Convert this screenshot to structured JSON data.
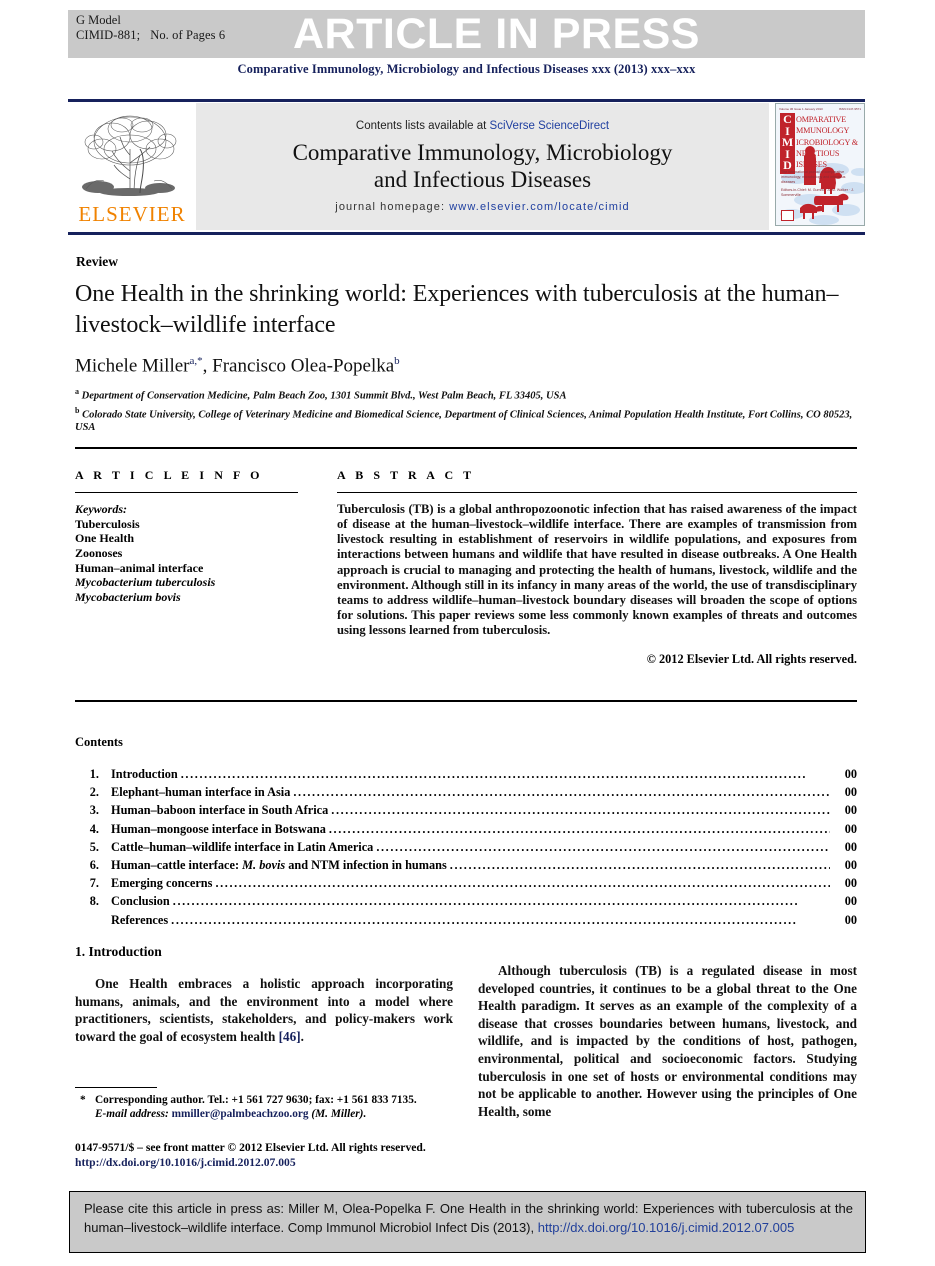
{
  "banner": {
    "gmodel_label": "G Model",
    "article_id": "CIMID-881;",
    "pages_label": "No. of Pages 6",
    "press_label": "ARTICLE IN PRESS"
  },
  "running_head": "Comparative Immunology, Microbiology and Infectious Diseases xxx (2013) xxx–xxx",
  "masthead": {
    "contents_prefix": "Contents lists available at",
    "sciencedirect": "SciVerse ScienceDirect",
    "journal_title_line1": "Comparative Immunology, Microbiology",
    "journal_title_line2": "and Infectious Diseases",
    "homepage_label": "journal homepage:",
    "homepage_url": "www.elsevier.com/locate/cimid",
    "publisher_wordmark": "ELSEVIER",
    "publisher_color": "#f08200",
    "accent_color": "#16215c",
    "cover": {
      "volume_line_left": "Volume 36  Issue 1  January 2013",
      "volume_line_right": "ISSN 0147-9571",
      "spine_code": "CIMID",
      "title_lines": [
        "OMPARATIVE",
        "MMUNOLOGY",
        "ICROBIOLOGY  &",
        "NFECTIOUS",
        "ISEASES"
      ],
      "subtitle": "The international journal of comparative immunology, microbiology and infectious diseases",
      "editors": "Editors-in-Chief: M. Gumbo · A. M. Walker · J. Sommerville"
    }
  },
  "article": {
    "type_label": "Review",
    "title": "One Health in the shrinking world: Experiences with tuberculosis at the human–livestock–wildlife interface",
    "author1": "Michele Miller",
    "author1_marks": "a,*",
    "author_sep": ", ",
    "author2": "Francisco Olea-Popelka",
    "author2_marks": "b",
    "affiliations": [
      {
        "mark": "a",
        "text": "Department of Conservation Medicine, Palm Beach Zoo, 1301 Summit Blvd., West Palm Beach, FL 33405, USA"
      },
      {
        "mark": "b",
        "text": "Colorado State University, College of Veterinary Medicine and Biomedical Science, Department of Clinical Sciences, Animal Population Health Institute, Fort Collins, CO 80523, USA"
      }
    ]
  },
  "article_info": {
    "heading": "A R T I C L E    I N F O",
    "keywords_label": "Keywords:",
    "keywords": [
      {
        "text": "Tuberculosis",
        "italic": false
      },
      {
        "text": "One Health",
        "italic": false
      },
      {
        "text": "Zoonoses",
        "italic": false
      },
      {
        "text": "Human–animal interface",
        "italic": false
      },
      {
        "text": "Mycobacterium tuberculosis",
        "italic": true
      },
      {
        "text": "Mycobacterium bovis",
        "italic": true
      }
    ]
  },
  "abstract": {
    "heading": "A B S T R A C T",
    "text": "Tuberculosis (TB) is a global anthropozoonotic infection that has raised awareness of the impact of disease at the human–livestock–wildlife interface. There are examples of transmission from livestock resulting in establishment of reservoirs in wildlife populations, and exposures from interactions between humans and wildlife that have resulted in disease outbreaks. A One Health approach is crucial to managing and protecting the health of humans, livestock, wildlife and the environment. Although still in its infancy in many areas of the world, the use of transdisciplinary teams to address wildlife–human–livestock boundary diseases will broaden the scope of options for solutions. This paper reviews some less commonly known examples of threats and outcomes using lessons learned from tuberculosis.",
    "copyright": "© 2012 Elsevier Ltd. All rights reserved."
  },
  "contents": {
    "heading": "Contents",
    "items": [
      {
        "num": "1.",
        "label": "Introduction",
        "page": "00"
      },
      {
        "num": "2.",
        "label": "Elephant–human interface in Asia",
        "page": "00"
      },
      {
        "num": "3.",
        "label": "Human–baboon interface in South Africa",
        "page": "00"
      },
      {
        "num": "4.",
        "label": "Human–mongoose interface in Botswana",
        "page": "00"
      },
      {
        "num": "5.",
        "label": "Cattle–human–wildlife interface in Latin America",
        "page": "00"
      },
      {
        "num": "6.",
        "label": "Human–cattle interface: M. bovis and NTM infection in humans",
        "page": "00"
      },
      {
        "num": "7.",
        "label": "Emerging concerns",
        "page": "00"
      },
      {
        "num": "8.",
        "label": "Conclusion",
        "page": "00"
      },
      {
        "num": "",
        "label": "References",
        "page": "00"
      }
    ]
  },
  "body": {
    "section_heading": "1.  Introduction",
    "left_paragraph": "One Health embraces a holistic approach incorporating humans, animals, and the environment into a model where practitioners, scientists, stakeholders, and policy-makers work toward the goal of ecosystem health",
    "left_citation": "[46]",
    "left_paragraph_end": ".",
    "right_paragraph": "Although tuberculosis (TB) is a regulated disease in most developed countries, it continues to be a global threat to the One Health paradigm. It serves as an example of the complexity of a disease that crosses boundaries between humans, livestock, and wildlife, and is impacted by the conditions of host, pathogen, environmental, political and socioeconomic factors. Studying tuberculosis in one set of hosts or environmental conditions may not be applicable to another. However using the principles of One Health, some"
  },
  "footnote": {
    "star": "*",
    "line1": "Corresponding author. Tel.: +1 561 727 9630; fax: +1 561 833 7135.",
    "email_label": "E-mail address:",
    "email": "mmiller@palmbeachzoo.org",
    "email_owner": "(M. Miller).",
    "front_matter": "0147-9571/$ – see front matter © 2012 Elsevier Ltd. All rights reserved.",
    "doi": "http://dx.doi.org/10.1016/j.cimid.2012.07.005"
  },
  "citation_box": {
    "text": "Please cite this article in press as: Miller M, Olea-Popelka F. One Health in the shrinking world: Experiences with tuberculosis at the human–livestock–wildlife interface. Comp Immunol Microbiol Infect Dis (2013),",
    "doi": "http://dx.doi.org/10.1016/j.cimid.2012.07.005"
  }
}
